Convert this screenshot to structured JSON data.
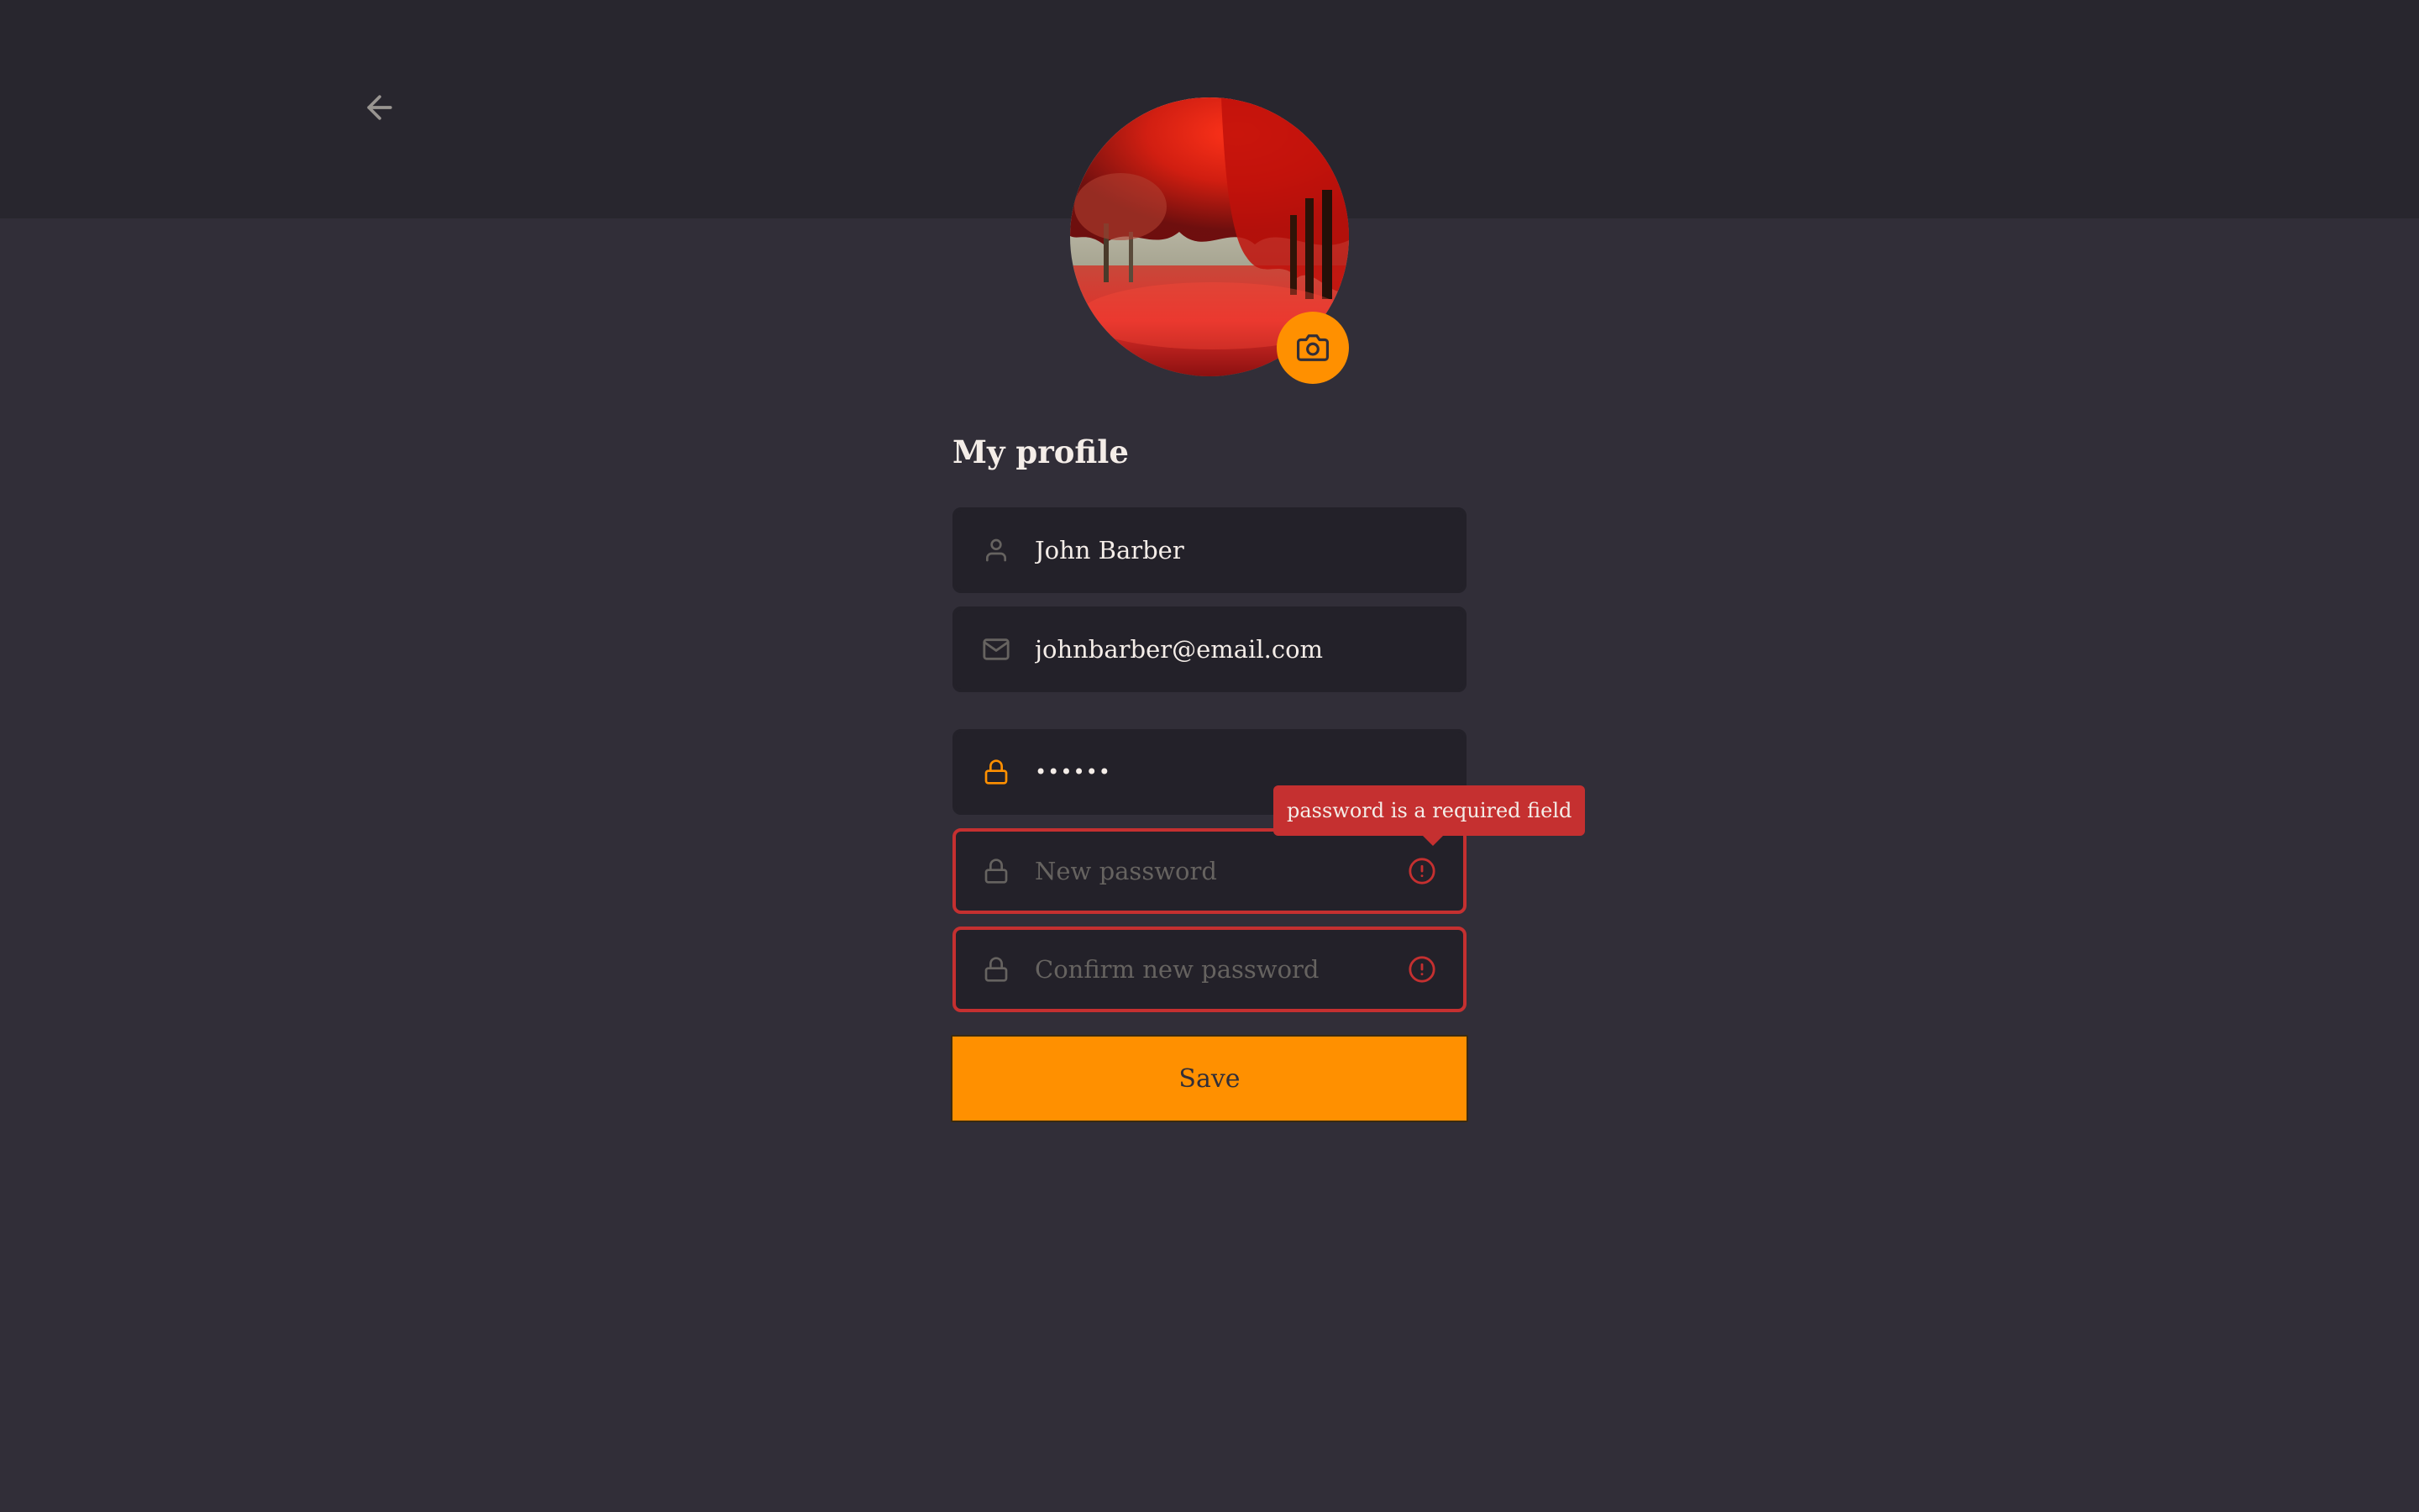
{
  "header": {
    "back_icon": "arrow-left-icon"
  },
  "avatar": {
    "image": "autumn-red-trees-photo",
    "camera_icon": "camera-icon"
  },
  "profile": {
    "title": "My profile",
    "name": {
      "value": "John Barber",
      "icon": "user-icon"
    },
    "email": {
      "value": "johnbarber@email.com",
      "icon": "mail-icon"
    },
    "old_password": {
      "value": "••••••",
      "icon": "lock-icon"
    },
    "new_password": {
      "value": "",
      "placeholder": "New password",
      "icon": "lock-icon",
      "error_icon": "alert-circle-icon"
    },
    "confirm_password": {
      "value": "",
      "placeholder": "Confirm new password",
      "icon": "lock-icon",
      "error_icon": "alert-circle-icon"
    },
    "error_tooltip": "password is a required field",
    "save_label": "Save"
  },
  "colors": {
    "background": "#312e38",
    "header": "#28262e",
    "input": "#232129",
    "accent": "#ff9000",
    "error": "#c53030",
    "text": "#f4ede8",
    "muted": "#666360"
  }
}
